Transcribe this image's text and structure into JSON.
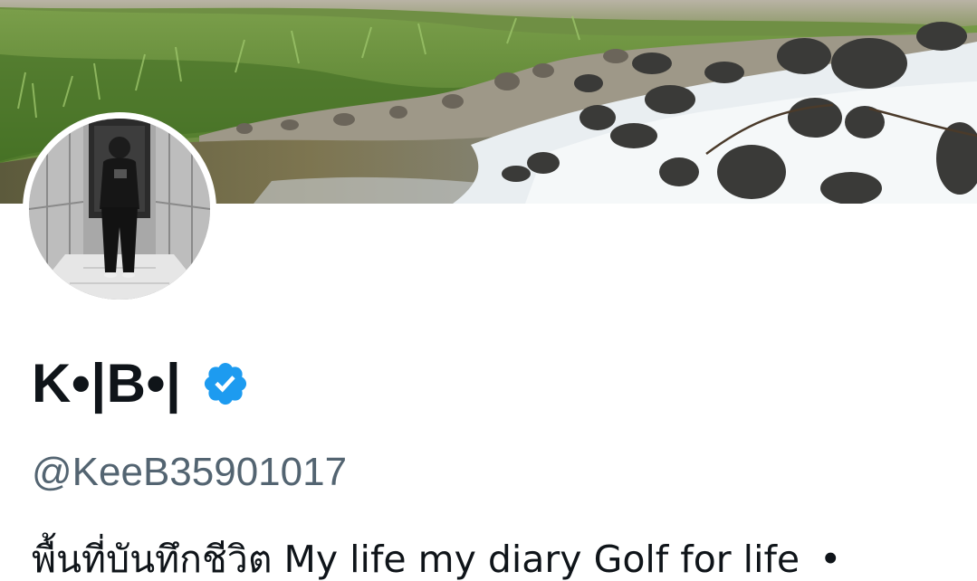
{
  "profile": {
    "display_name": "K•|B•|",
    "handle": "@KeeB35901017",
    "bio_text": "พื้นที่บันทึกชีวิต  My life my diary Golf for life",
    "bio_separator": "•",
    "verified": true
  },
  "banner": {
    "scene": "river with rocks and cascading water beside grassy bank"
  },
  "avatar": {
    "scene": "black and white mirror photo of person in elevator"
  },
  "colors": {
    "name_text": "#0f1419",
    "handle_text": "#536471",
    "verified_badge": "#1d9bf0",
    "background": "#ffffff"
  }
}
